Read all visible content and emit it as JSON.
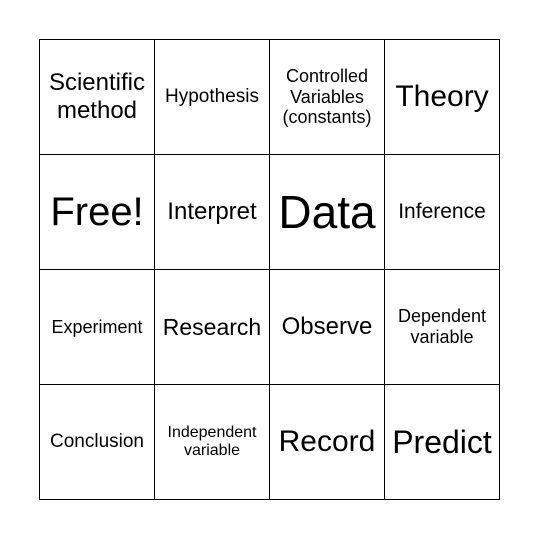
{
  "board": {
    "rows": [
      [
        {
          "text": "Scientific method",
          "size": 24
        },
        {
          "text": "Hypothesis",
          "size": 19
        },
        {
          "text": "Controlled Variables (constants)",
          "size": 18
        },
        {
          "text": "Theory",
          "size": 30
        }
      ],
      [
        {
          "text": "Free!",
          "size": 40
        },
        {
          "text": "Interpret",
          "size": 24
        },
        {
          "text": "Data",
          "size": 46
        },
        {
          "text": "Inference",
          "size": 21
        }
      ],
      [
        {
          "text": "Experiment",
          "size": 18
        },
        {
          "text": "Research",
          "size": 23
        },
        {
          "text": "Observe",
          "size": 24
        },
        {
          "text": "Dependent variable",
          "size": 18
        }
      ],
      [
        {
          "text": "Conclusion",
          "size": 19
        },
        {
          "text": "Independent variable",
          "size": 16
        },
        {
          "text": "Record",
          "size": 30
        },
        {
          "text": "Predict",
          "size": 32
        }
      ]
    ]
  }
}
